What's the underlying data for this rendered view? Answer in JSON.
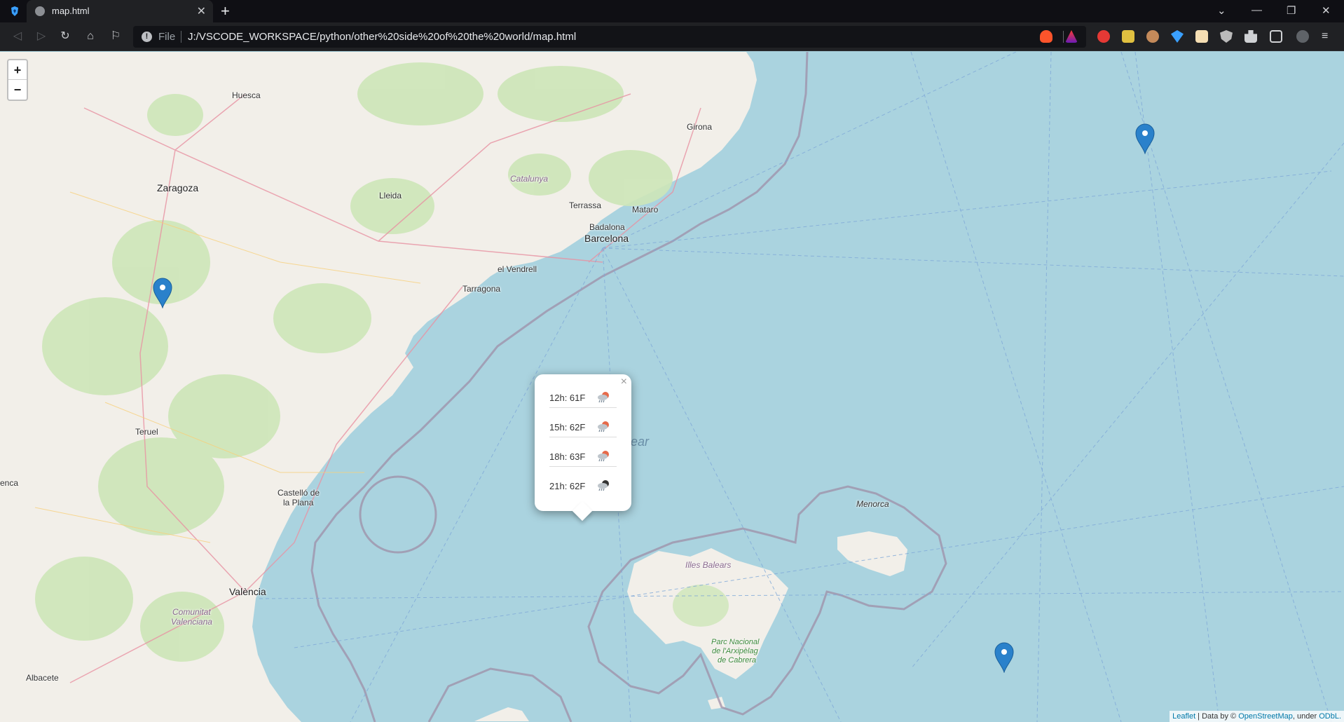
{
  "browser": {
    "tab_title": "map.html",
    "url_scheme": "File",
    "url": "J:/VSCODE_WORKSPACE/python/other%20side%20of%20the%20world/map.html",
    "colors": {
      "chrome_bg": "#0f0f14",
      "toolbar_bg": "#202124",
      "omnibox_bg": "#121317"
    }
  },
  "map": {
    "zoom_in_label": "+",
    "zoom_out_label": "−",
    "labels": {
      "huesca": "Huesca",
      "zaragoza": "Zaragoza",
      "lleida": "Lleida",
      "catalunya": "Catalunya",
      "girona": "Girona",
      "terrassa": "Terrassa",
      "mataro": "Mataro",
      "badalona": "Badalona",
      "barcelona": "Barcelona",
      "el_vendrell": "el Vendrell",
      "tarragona": "Tarragona",
      "teruel": "Teruel",
      "castello_1": "Castelló de",
      "castello_2": "la Plana",
      "valencia": "València",
      "comunitat_1": "Comunitat",
      "comunitat_2": "Valenciana",
      "albacete": "Albacete",
      "cuenca": "enca",
      "menorca": "Menorca",
      "illes_balears": "Illes Balears",
      "parc_1": "Parc Nacional",
      "parc_2": "de l'Arxipèlag",
      "parc_3": "de Cabrera",
      "sea_fragment": "ear"
    },
    "markers": [
      {
        "name": "marker-west"
      },
      {
        "name": "marker-northeast"
      },
      {
        "name": "marker-center"
      },
      {
        "name": "marker-southeast"
      }
    ],
    "popup": {
      "close_label": "×",
      "forecast": [
        {
          "text": "12h: 61F",
          "icon": "rain-cloud-icon"
        },
        {
          "text": "15h: 62F",
          "icon": "rain-cloud-icon"
        },
        {
          "text": "18h: 63F",
          "icon": "rain-cloud-icon"
        },
        {
          "text": "21h: 62F",
          "icon": "night-rain-cloud-icon"
        }
      ]
    },
    "attribution": {
      "leaflet": "Leaflet",
      "data_by": " | Data by © ",
      "osm": "OpenStreetMap",
      "under": ", under ",
      "odbl": "ODbL."
    },
    "colors": {
      "sea": "#aad3df",
      "land": "#f2efe9",
      "forest": "#cde6b8",
      "marker": "#2a81cb",
      "boundary": "#9e8fa8"
    }
  }
}
